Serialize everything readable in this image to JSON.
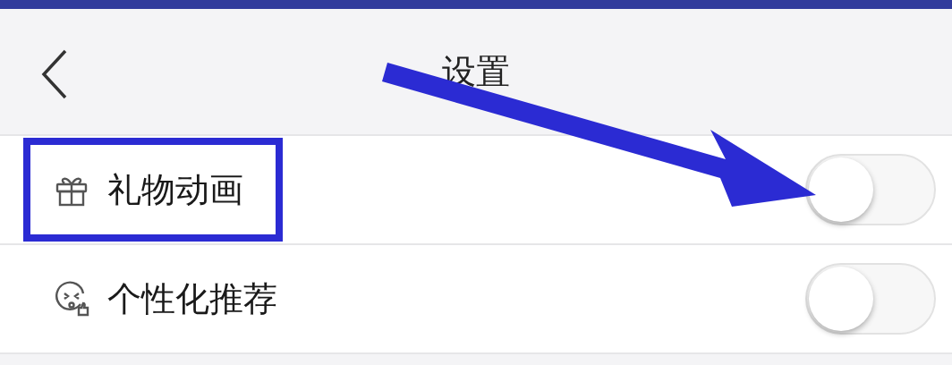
{
  "header": {
    "title": "设置"
  },
  "rows": [
    {
      "kind": "gift",
      "label": "礼物动画",
      "on": false,
      "highlighted": true
    },
    {
      "kind": "emoji",
      "label": "个性化推荐",
      "on": false,
      "highlighted": false
    }
  ]
}
